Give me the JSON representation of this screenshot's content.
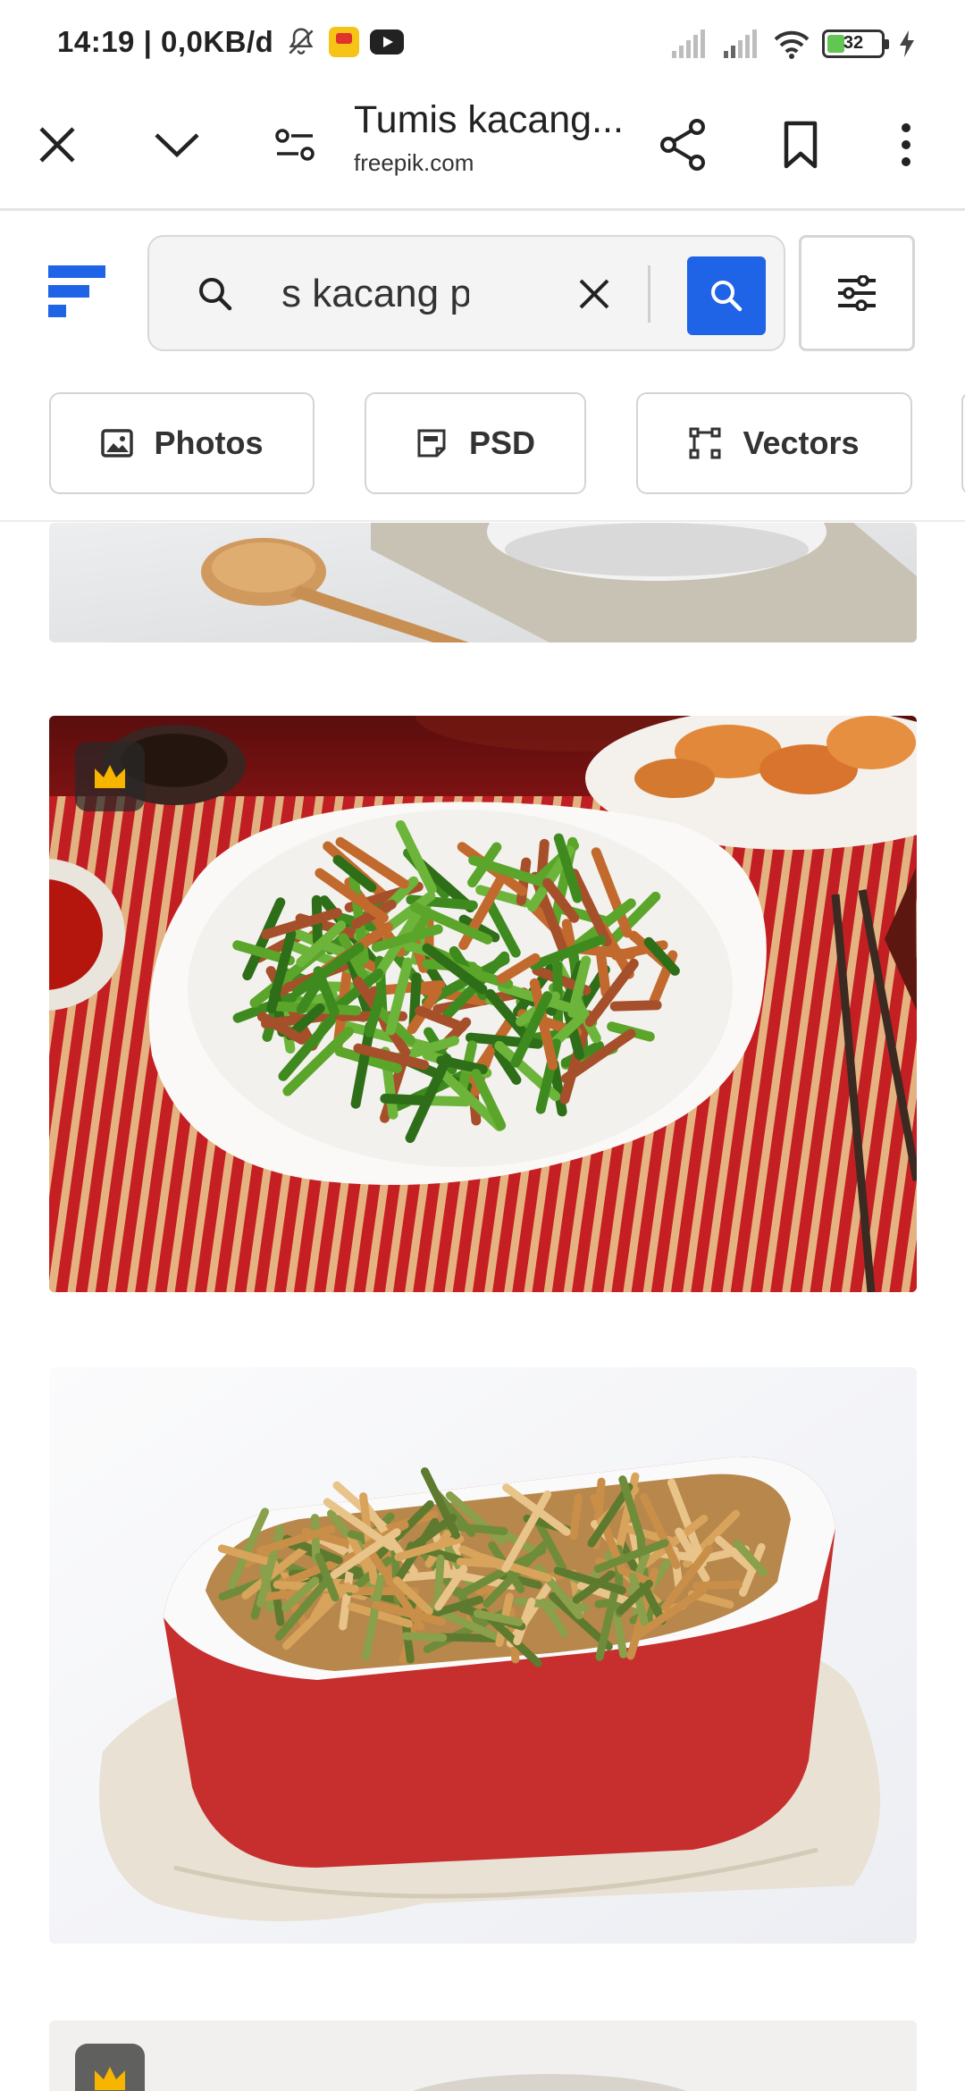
{
  "status_bar": {
    "time_and_speed": "14:19 | 0,0KB/d",
    "battery_level": "32",
    "battery_fraction": 0.32
  },
  "browser": {
    "page_title": "Tumis kacang...",
    "domain": "freepik.com"
  },
  "freepik": {
    "search": {
      "value": "s kacang pa",
      "placeholder": ""
    },
    "chips": [
      {
        "label": "Photos",
        "icon": "image-icon"
      },
      {
        "label": "PSD",
        "icon": "psd-file-icon"
      },
      {
        "label": "Vectors",
        "icon": "vector-icon"
      }
    ]
  },
  "results": [
    {
      "type": "photo",
      "premium": false,
      "subject": "bowl-with-wooden-spoon"
    },
    {
      "type": "photo",
      "premium": true,
      "subject": "stir-fried-green-beans-plate"
    },
    {
      "type": "photo",
      "premium": false,
      "subject": "green-bean-casserole-red-dish"
    },
    {
      "type": "photo",
      "premium": true,
      "subject": "partial-next-photo"
    }
  ],
  "colors": {
    "accent_blue": "#1f63e6",
    "premium_crown": "#f7b500",
    "battery_green": "#62c554"
  }
}
